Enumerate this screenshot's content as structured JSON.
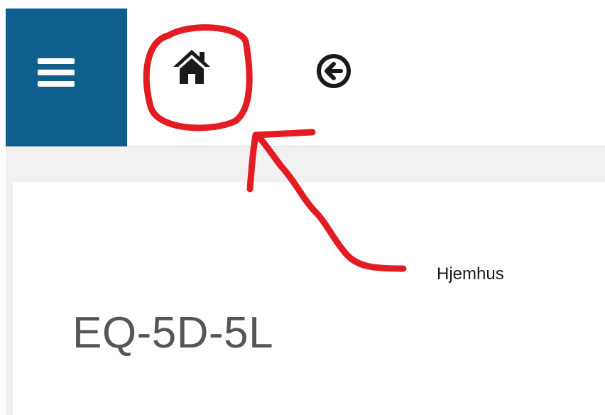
{
  "header": {
    "menu_icon": "hamburger-menu-icon",
    "home_icon": "home-icon",
    "back_icon": "circle-arrow-left-icon"
  },
  "main": {
    "title": "EQ-5D-5L"
  },
  "annotation": {
    "label": "Hjemhus",
    "marker_color": "#e31b23"
  },
  "colors": {
    "menu_tile": "#0e5f8e",
    "icon": "#1a1a1a",
    "background_band": "#f1f1f1",
    "title_text": "#555555"
  }
}
